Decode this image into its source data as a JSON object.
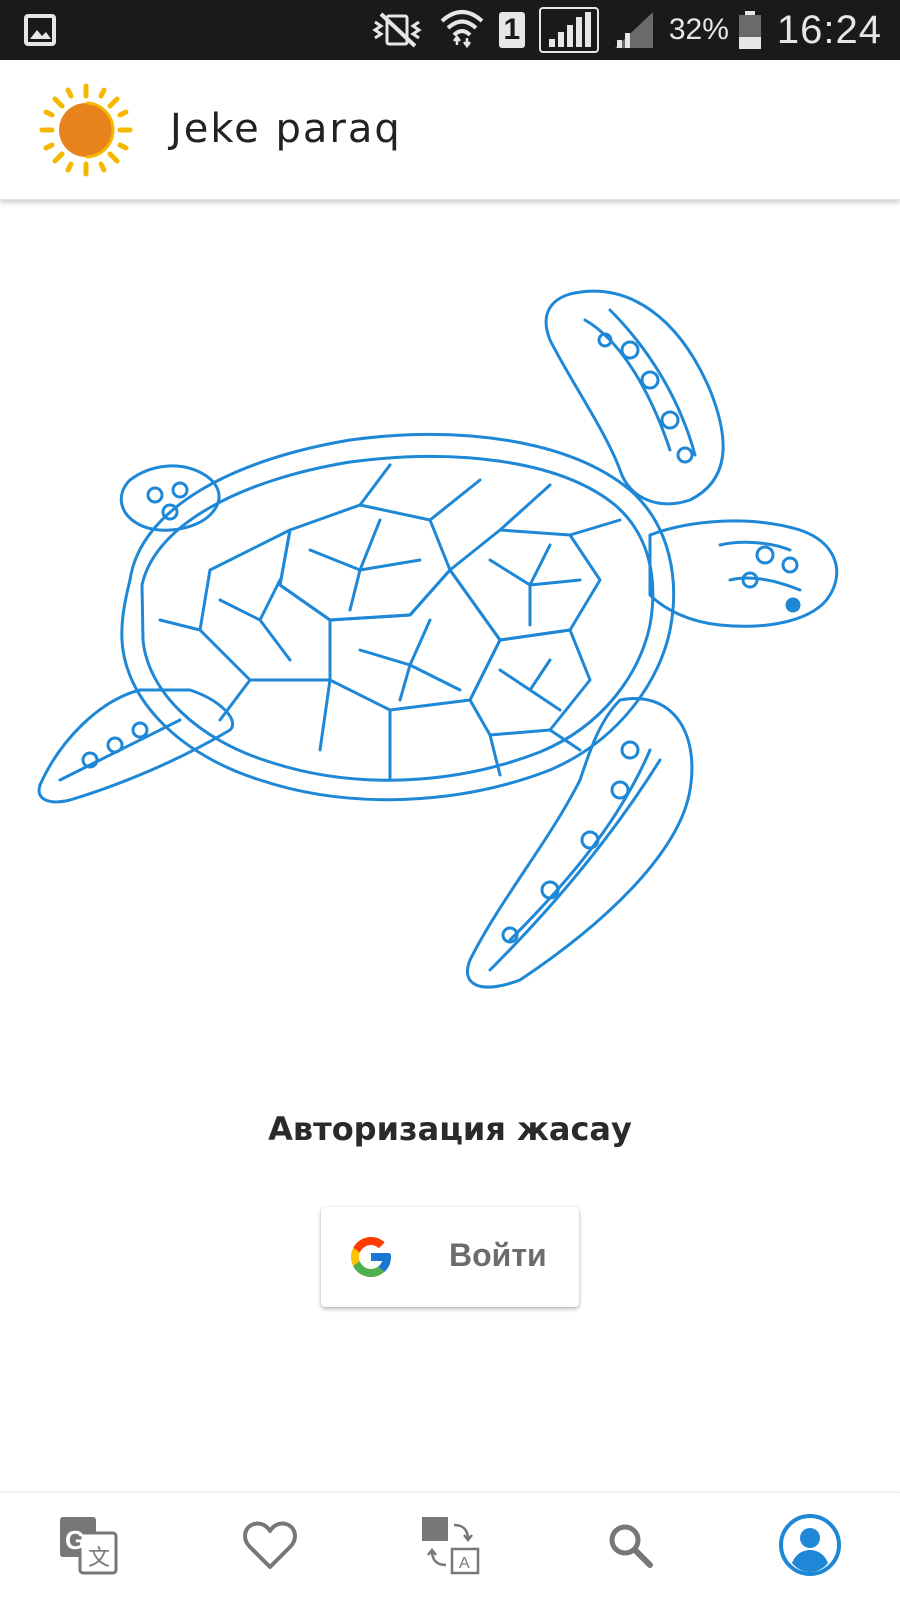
{
  "status_bar": {
    "battery_percent": "32%",
    "time": "16:24",
    "sim_slot": "1",
    "icons": [
      "gallery-notification-icon",
      "vibrate-mute-icon",
      "wifi-icon",
      "sim-badge-icon",
      "signal-icon",
      "signal-secondary-icon",
      "battery-icon"
    ]
  },
  "app_bar": {
    "title": "Jeke paraq",
    "logo_icon": "sun-logo-icon"
  },
  "hero": {
    "illustration": "sea-turtle-illustration",
    "stroke_color": "#1e88d6"
  },
  "auth": {
    "title": "Авторизация жасау",
    "login_button_label": "Войти",
    "login_button_icon": "google-icon"
  },
  "bottom_nav": {
    "items": [
      {
        "id": "translate",
        "icon": "translate-icon",
        "active": false
      },
      {
        "id": "favorites",
        "icon": "heart-icon",
        "active": false
      },
      {
        "id": "convert",
        "icon": "convert-icon",
        "active": false
      },
      {
        "id": "search",
        "icon": "search-icon",
        "active": false
      },
      {
        "id": "account",
        "icon": "account-icon",
        "active": true
      }
    ],
    "active_color": "#1e88d6",
    "inactive_color": "#777777"
  }
}
